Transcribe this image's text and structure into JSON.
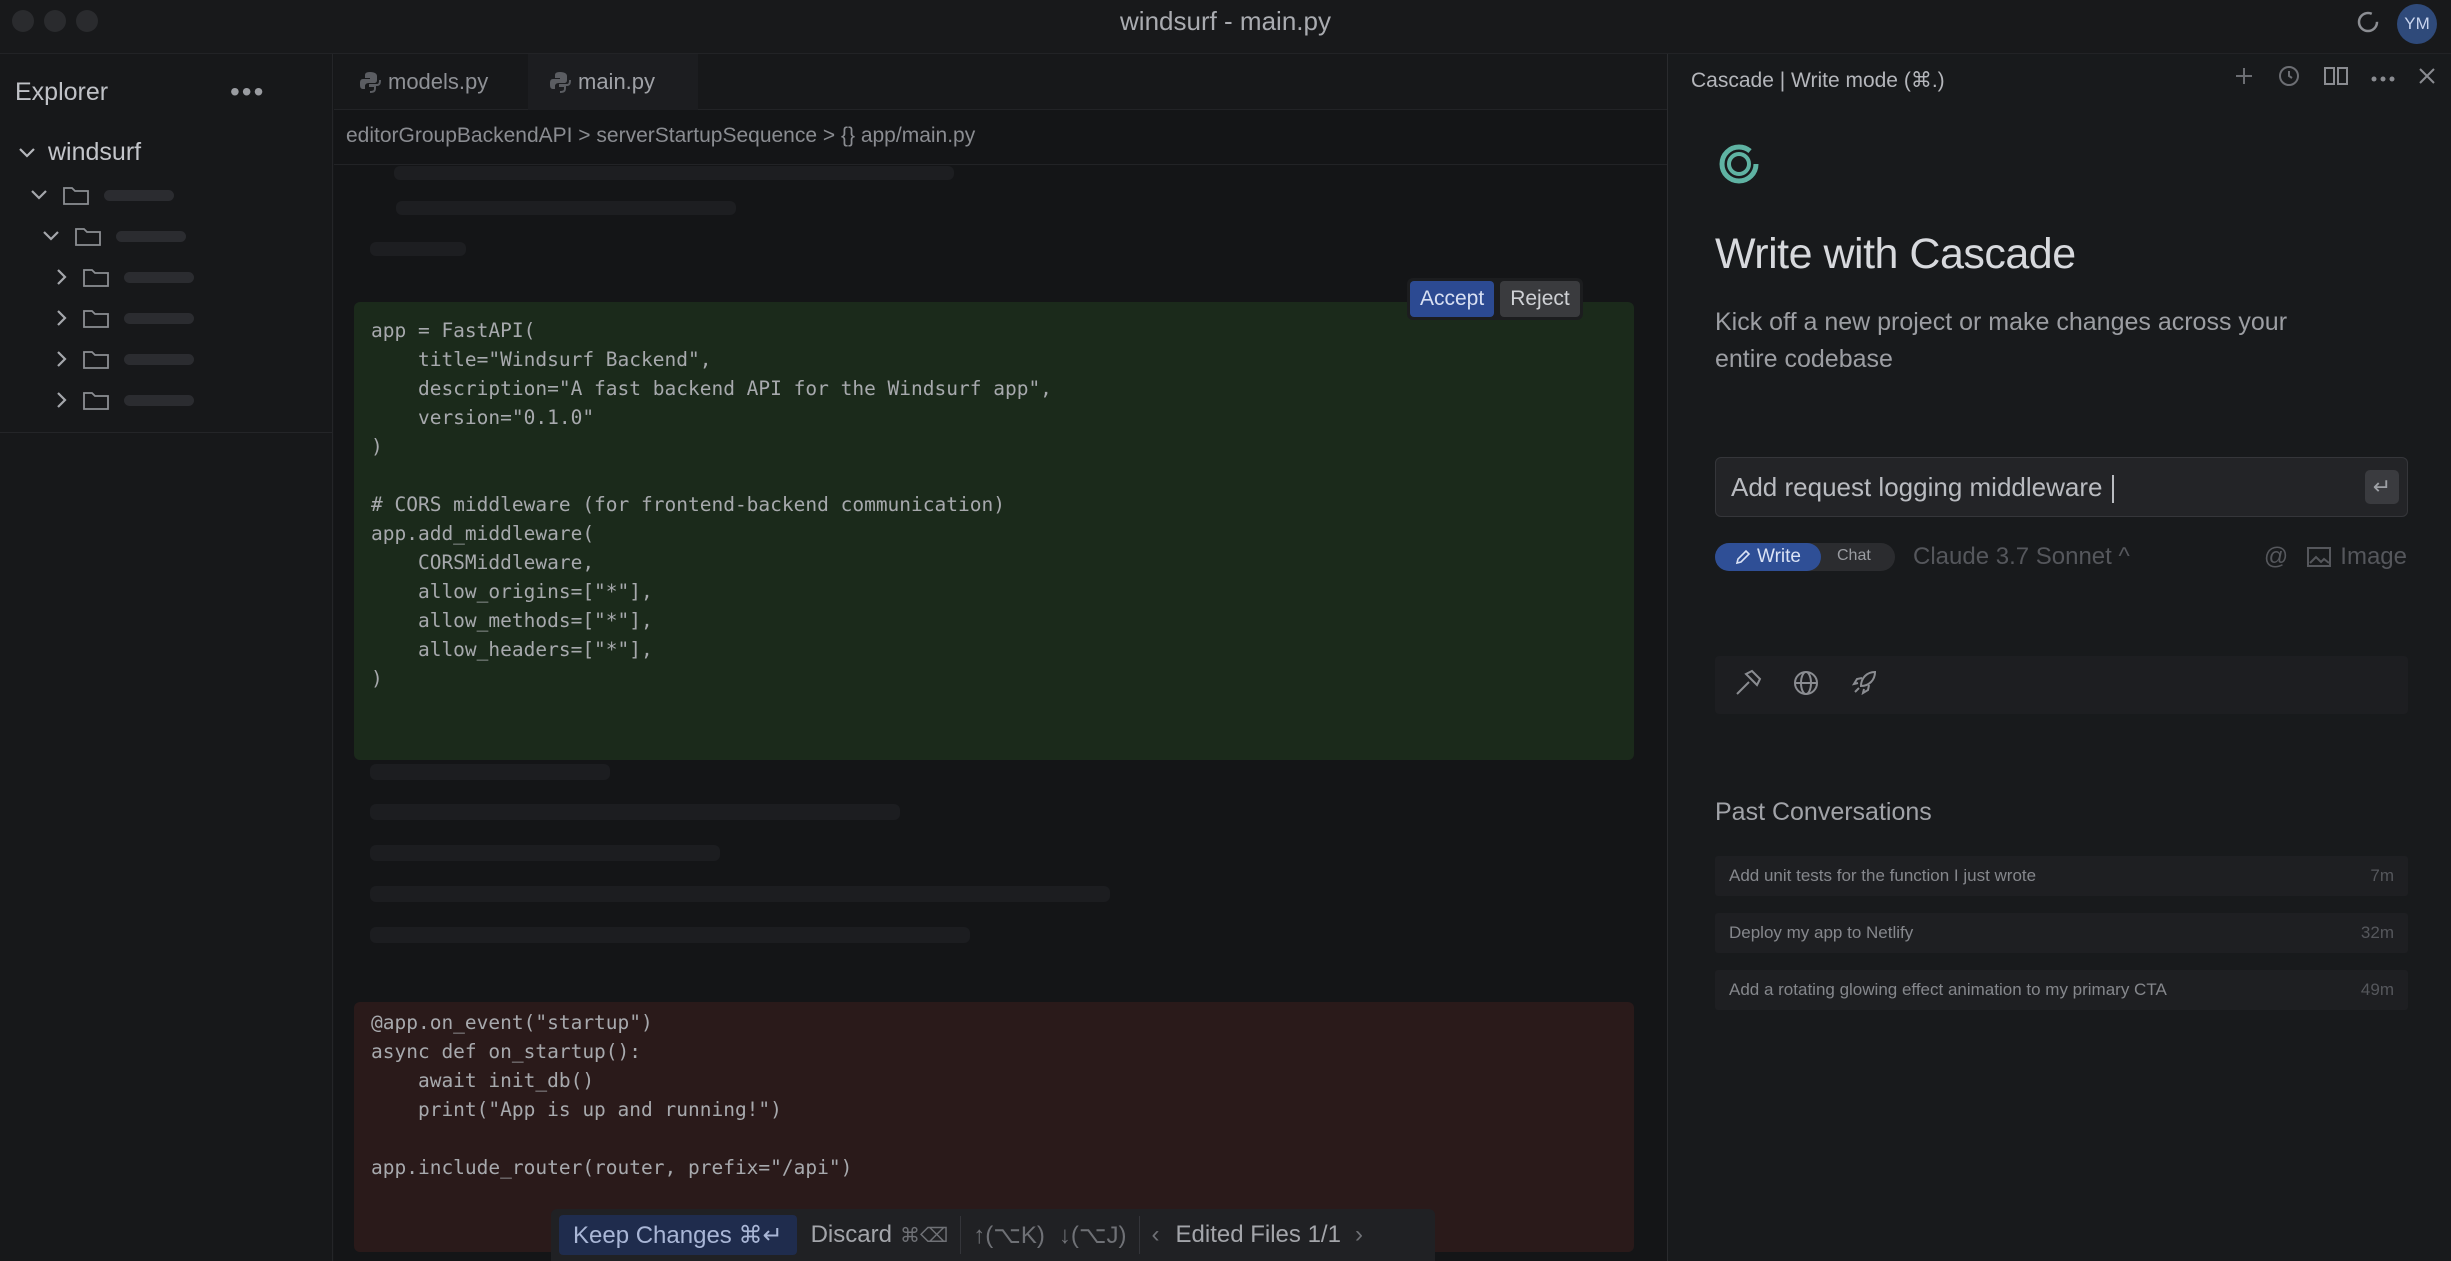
{
  "window": {
    "title": "windsurf - main.py",
    "avatar_initials": "YM"
  },
  "explorer": {
    "title": "Explorer",
    "more_label": "•••",
    "root_folder": "windsurf"
  },
  "editor": {
    "tabs": [
      {
        "label": "models.py",
        "icon": "python-icon"
      },
      {
        "label": "main.py",
        "icon": "python-icon",
        "active": true
      }
    ],
    "breadcrumb": "editorGroupBackendAPI > serverStartupSequence > {} app/main.py",
    "added_code": "app = FastAPI(\n    title=\"Windsurf Backend\",\n    description=\"A fast backend API for the Windsurf app\",\n    version=\"0.1.0\"\n)\n\n# CORS middleware (for frontend-backend communication)\napp.add_middleware(\n    CORSMiddleware,\n    allow_origins=[\"*\"],\n    allow_methods=[\"*\"],\n    allow_headers=[\"*\"],\n)",
    "removed_code": "@app.on_event(\"startup\")\nasync def on_startup():\n    await init_db()\n    print(\"App is up and running!\")",
    "removed_code_dim": "app.include_router(router, prefix=\"/api\")",
    "accept_label": "Accept",
    "reject_label": "Reject",
    "bottom_bar": {
      "keep_label": "Keep Changes ⌘↵",
      "discard_label": "Discard",
      "discard_shortcut": "⌘⌫",
      "up_label": "↑(⌥K)",
      "down_label": "↓(⌥J)",
      "prev": "‹",
      "edited_files": "Edited Files 1/1",
      "next": "›"
    }
  },
  "cascade": {
    "header": "Cascade | Write mode (⌘.)",
    "title": "Write with Cascade",
    "subtitle": "Kick off a new project or make changes across your entire codebase",
    "prompt_value": "Add request logging middleware",
    "enter_symbol": "↵",
    "mode_write": "Write",
    "mode_chat": "Chat",
    "model": "Claude 3.7 Sonnet ^",
    "at_symbol": "@",
    "image_label": "Image",
    "past_title": "Past Conversations",
    "conversations": [
      {
        "title": "Add unit tests for the function I just wrote",
        "time": "7m"
      },
      {
        "title": "Deploy my app to Netlify",
        "time": "32m"
      },
      {
        "title": "Add a rotating glowing effect animation to my primary CTA",
        "time": "49m"
      }
    ],
    "accent_color": "#5fb3a3"
  }
}
